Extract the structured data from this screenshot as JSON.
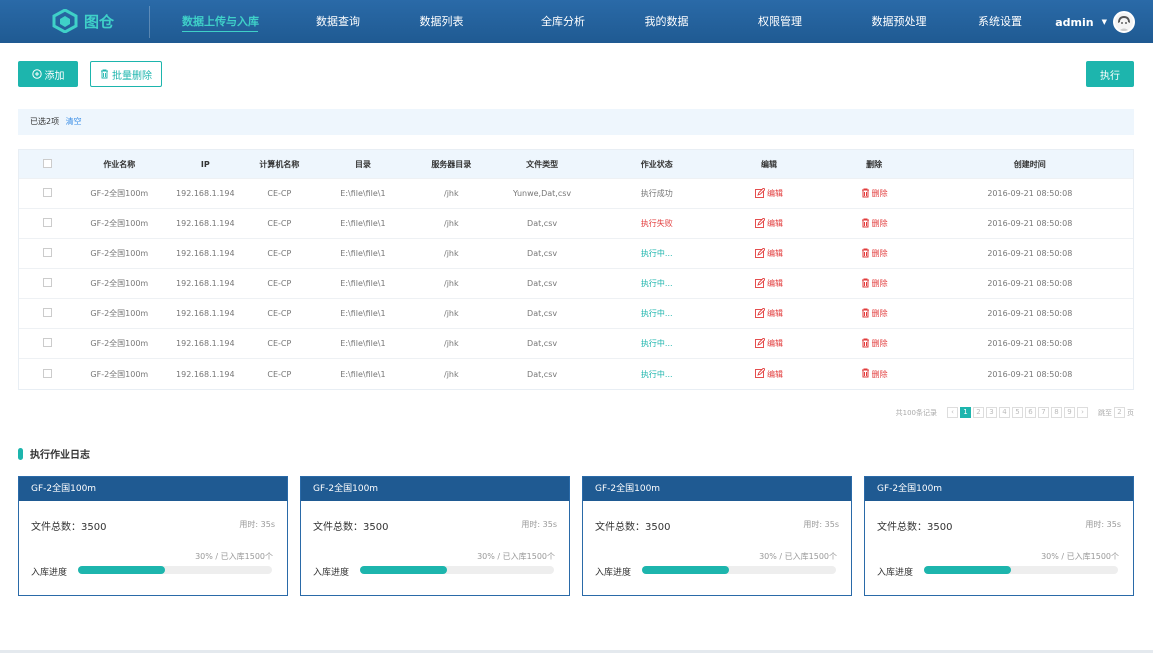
{
  "header": {
    "logo_text": "图仓",
    "nav": [
      {
        "label": "数据上传与入库",
        "active": true,
        "width": 76
      },
      {
        "label": "数据查询",
        "active": false,
        "width": 76
      },
      {
        "label": "数据列表",
        "active": false,
        "width": 91
      },
      {
        "label": "全库分析",
        "active": false,
        "width": 80
      },
      {
        "label": "我的数据",
        "active": false,
        "width": 77
      },
      {
        "label": "权限管理",
        "active": false,
        "width": 86
      },
      {
        "label": "数据预处理",
        "active": false,
        "width": 88
      },
      {
        "label": "系统设置",
        "active": false,
        "width": 50
      }
    ],
    "username": "admin"
  },
  "toolbar": {
    "add_label": "添加",
    "batch_delete_label": "批量删除",
    "execute_label": "执行"
  },
  "selection": {
    "text": "已选2项",
    "clear_label": "清空"
  },
  "table": {
    "headers": [
      "作业名称",
      "IP",
      "计算机名称",
      "目录",
      "服务器目录",
      "文件类型",
      "作业状态",
      "编辑",
      "删除",
      "创建时间"
    ],
    "edit_label": "编辑",
    "delete_label": "删除",
    "rows": [
      {
        "name": "GF-2全国100m",
        "ip": "192.168.1.194",
        "computer": "CE-CP",
        "dir": "E:\\file\\file\\1",
        "server_dir": "/jhk",
        "file_type": "Yunwe,Dat,csv",
        "status": "执行成功",
        "status_type": "ok",
        "created": "2016-09-21  08:50:08"
      },
      {
        "name": "GF-2全国100m",
        "ip": "192.168.1.194",
        "computer": "CE-CP",
        "dir": "E:\\file\\file\\1",
        "server_dir": "/jhk",
        "file_type": "Dat,csv",
        "status": "执行失败",
        "status_type": "fail",
        "created": "2016-09-21  08:50:08"
      },
      {
        "name": "GF-2全国100m",
        "ip": "192.168.1.194",
        "computer": "CE-CP",
        "dir": "E:\\file\\file\\1",
        "server_dir": "/jhk",
        "file_type": "Dat,csv",
        "status": "执行中...",
        "status_type": "run",
        "created": "2016-09-21  08:50:08"
      },
      {
        "name": "GF-2全国100m",
        "ip": "192.168.1.194",
        "computer": "CE-CP",
        "dir": "E:\\file\\file\\1",
        "server_dir": "/jhk",
        "file_type": "Dat,csv",
        "status": "执行中...",
        "status_type": "run",
        "created": "2016-09-21  08:50:08"
      },
      {
        "name": "GF-2全国100m",
        "ip": "192.168.1.194",
        "computer": "CE-CP",
        "dir": "E:\\file\\file\\1",
        "server_dir": "/jhk",
        "file_type": "Dat,csv",
        "status": "执行中...",
        "status_type": "run",
        "created": "2016-09-21  08:50:08"
      },
      {
        "name": "GF-2全国100m",
        "ip": "192.168.1.194",
        "computer": "CE-CP",
        "dir": "E:\\file\\file\\1",
        "server_dir": "/jhk",
        "file_type": "Dat,csv",
        "status": "执行中...",
        "status_type": "run",
        "created": "2016-09-21  08:50:08"
      },
      {
        "name": "GF-2全国100m",
        "ip": "192.168.1.194",
        "computer": "CE-CP",
        "dir": "E:\\file\\file\\1",
        "server_dir": "/jhk",
        "file_type": "Dat,csv",
        "status": "执行中...",
        "status_type": "run",
        "created": "2016-09-21  08:50:08"
      }
    ]
  },
  "pagination": {
    "total_text": "共100条记录",
    "pages": [
      "1",
      "2",
      "3",
      "4",
      "5",
      "6",
      "7",
      "8",
      "9"
    ],
    "current": "1",
    "jump_label": "跳至",
    "jump_value": "2",
    "page_unit": "页"
  },
  "log": {
    "title": "执行作业日志",
    "cards": [
      {
        "title": "GF-2全国100m",
        "total_label": "文件总数：",
        "total": "3500",
        "time": "用时: 35s",
        "progress_text": "30% / 已入库1500个",
        "progress_label": "入库进度",
        "progress": 0.45
      },
      {
        "title": "GF-2全国100m",
        "total_label": "文件总数：",
        "total": "3500",
        "time": "用时: 35s",
        "progress_text": "30% / 已入库1500个",
        "progress_label": "入库进度",
        "progress": 0.45
      },
      {
        "title": "GF-2全国100m",
        "total_label": "文件总数：",
        "total": "3500",
        "time": "用时: 35s",
        "progress_text": "30% / 已入库1500个",
        "progress_label": "入库进度",
        "progress": 0.45
      },
      {
        "title": "GF-2全国100m",
        "total_label": "文件总数：",
        "total": "3500",
        "time": "用时: 35s",
        "progress_text": "30% / 已入库1500个",
        "progress_label": "入库进度",
        "progress": 0.45
      }
    ]
  },
  "colors": {
    "primary": "#1db5ad",
    "header_bg": "#1f5a92",
    "danger": "#e23b3b"
  }
}
